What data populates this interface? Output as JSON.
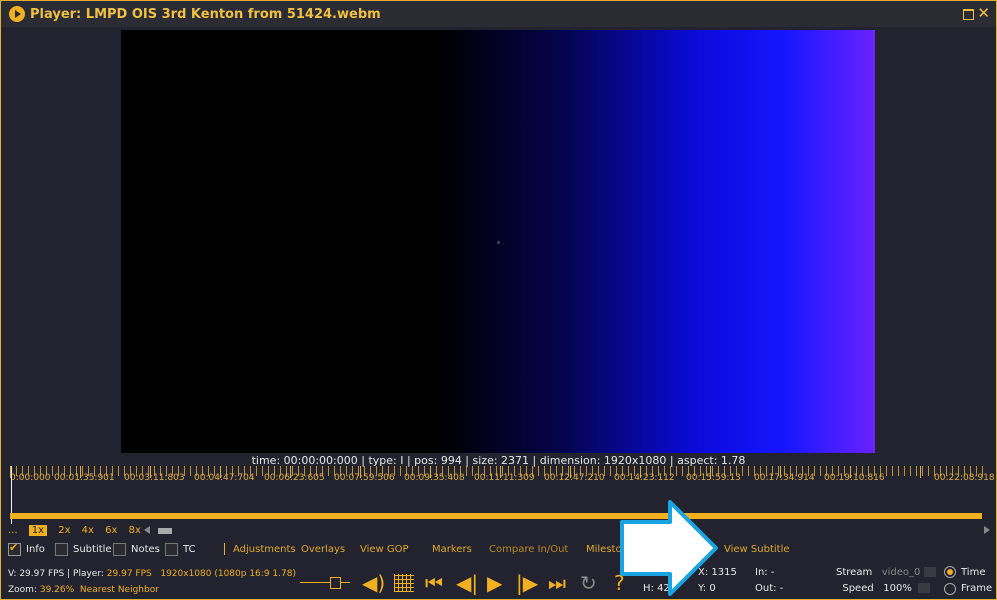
{
  "window": {
    "title": "Player: LMPD OIS 3rd  Kenton from 51424.webm"
  },
  "video": {
    "info": "time: 00:00:00:000 | type: I | pos: 994 | size: 2371 | dimension: 1920x1080 | aspect: 1.78"
  },
  "timeline": {
    "ticks": [
      "0:00:000",
      "00:01:35:901",
      "00:03:11:803",
      "00:04:47:704",
      "00:06:23:605",
      "00:07:59:506",
      "00:09:35:408",
      "00:11:11:309",
      "00:12:47:210",
      "00:14:23:112",
      "00:15:59:13",
      "00:17:34:914",
      "00:19:10:816",
      "00:22:08:918"
    ],
    "zoom_levels": [
      "...",
      "1x",
      "2x",
      "4x",
      "6x",
      "8x"
    ]
  },
  "toolbar": {
    "info_label": "Info",
    "subtitle_label": "Subtitle",
    "notes_label": "Notes",
    "tc_label": "TC",
    "adjustments": "Adjustments",
    "overlays": "Overlays",
    "view_gop": "View GOP",
    "markers": "Markers",
    "compare": "Compare In/Out",
    "milestones": "Milestones",
    "view_subtitle": "View Subtitle"
  },
  "status": {
    "v_fps": "V: 29.97 FPS",
    "player_label": "Player:",
    "player_fps": "29.97 FPS",
    "resolution": "1920x1080 (1080p 16:9 1.78)",
    "zoom_label": "Zoom:",
    "zoom_value": "39.26%",
    "filter": "Nearest Neighbor"
  },
  "coords": {
    "w": "W:",
    "h": "H: 42",
    "x": "X: 1315",
    "y": "Y: 0",
    "in": "In: -",
    "out": "Out: -"
  },
  "stream": {
    "stream_label": "Stream",
    "stream_value": "video_0",
    "speed_label": "Speed",
    "speed_value": "100%",
    "time_label": "Time",
    "frame_label": "Frame"
  },
  "controls": {
    "help": "?"
  },
  "colors": {
    "accent": "#f0b020",
    "background": "#232330",
    "callout": "#19a3e0"
  }
}
